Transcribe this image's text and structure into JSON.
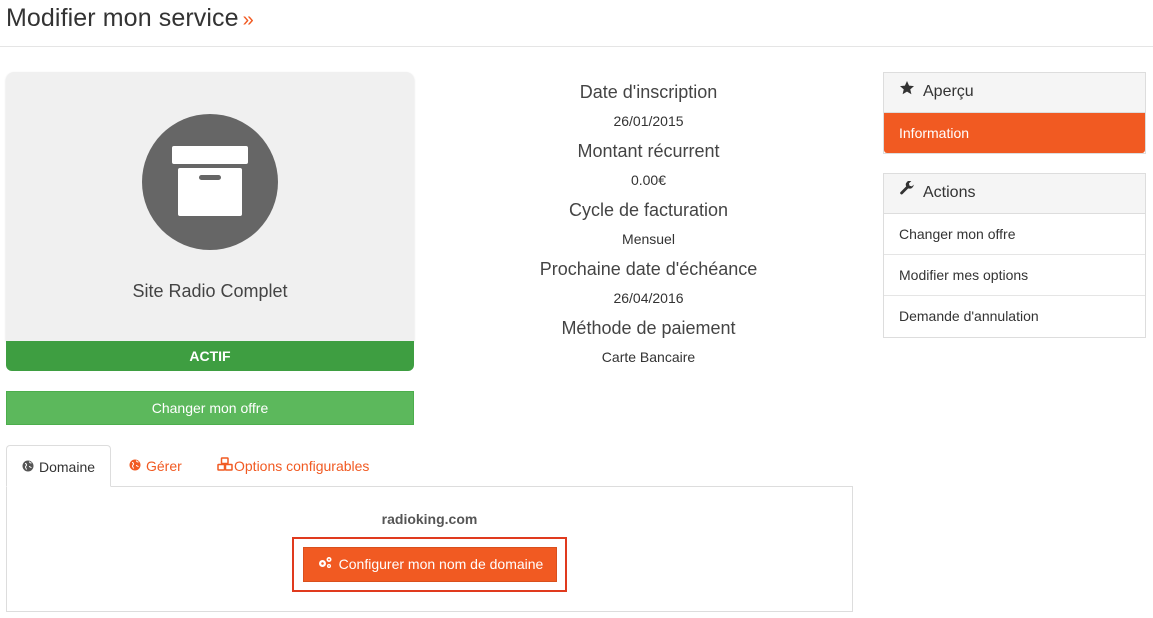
{
  "header": {
    "title": "Modifier mon service",
    "chevron": "»"
  },
  "product": {
    "icon": "archive-box-icon",
    "name": "Site Radio Complet",
    "status": "ACTIF",
    "change_button": "Changer mon offre",
    "colors": {
      "card_bg": "#f0f0f0",
      "status_bg": "#3e9e41",
      "button_bg": "#5cb85c"
    }
  },
  "details": [
    {
      "label": "Date d'inscription",
      "value": "26/01/2015"
    },
    {
      "label": "Montant récurrent",
      "value": "0.00€"
    },
    {
      "label": "Cycle de facturation",
      "value": "Mensuel"
    },
    {
      "label": "Prochaine date d'échéance",
      "value": "26/04/2016"
    },
    {
      "label": "Méthode de paiement",
      "value": "Carte Bancaire"
    }
  ],
  "sidebar": {
    "overview": {
      "title": "Aperçu",
      "icon": "star-icon",
      "items": [
        {
          "label": "Information",
          "active": true
        }
      ]
    },
    "actions": {
      "title": "Actions",
      "icon": "wrench-icon",
      "items": [
        {
          "label": "Changer mon offre"
        },
        {
          "label": "Modifier mes options"
        },
        {
          "label": "Demande d'annulation"
        }
      ]
    }
  },
  "tabs": [
    {
      "label": "Domaine",
      "icon": "globe-icon",
      "active": true
    },
    {
      "label": "Gérer",
      "icon": "globe-icon",
      "active": false
    },
    {
      "label": "Options configurables",
      "icon": "cubes-icon",
      "active": false
    }
  ],
  "domain_tab": {
    "domain": "radioking.com",
    "configure_button": "Configurer mon nom de domaine",
    "configure_icon": "gears-icon"
  },
  "accent_color": "#f15a22"
}
